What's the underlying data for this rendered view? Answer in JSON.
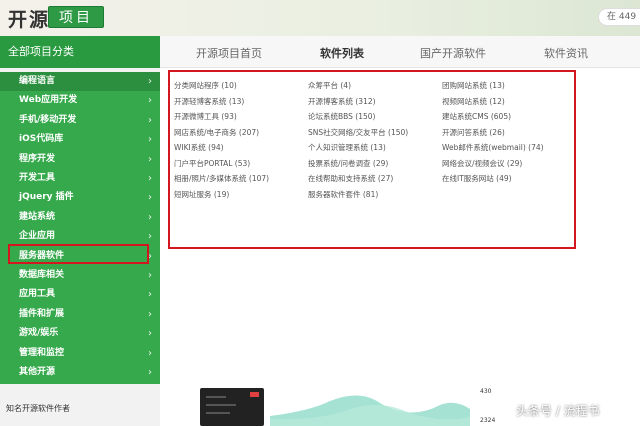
{
  "header": {
    "logo": "开源",
    "logo_tag": "项目",
    "search_text": "在 449"
  },
  "sidebar": {
    "title": "全部项目分类",
    "chevron": "›",
    "items": [
      {
        "label": "编程语言",
        "active": true
      },
      {
        "label": "Web应用开发",
        "active": false
      },
      {
        "label": "手机/移动开发",
        "active": false
      },
      {
        "label": "iOS代码库",
        "active": false
      },
      {
        "label": "程序开发",
        "active": false
      },
      {
        "label": "开发工具",
        "active": false
      },
      {
        "label": "jQuery 插件",
        "active": false
      },
      {
        "label": "建站系统",
        "active": true
      },
      {
        "label": "企业应用",
        "active": false
      },
      {
        "label": "服务器软件",
        "active": false
      },
      {
        "label": "数据库相关",
        "active": false
      },
      {
        "label": "应用工具",
        "active": false
      },
      {
        "label": "插件和扩展",
        "active": false
      },
      {
        "label": "游戏/娱乐",
        "active": false
      },
      {
        "label": "管理和监控",
        "active": false
      },
      {
        "label": "其他开源",
        "active": false
      }
    ],
    "bottom_label": "知名开源软件作者"
  },
  "tabs": [
    {
      "label": "开源项目首页",
      "active": false
    },
    {
      "label": "软件列表",
      "active": true
    },
    {
      "label": "国产开源软件",
      "active": false
    },
    {
      "label": "软件资讯",
      "active": false
    }
  ],
  "categories": [
    [
      "分类网站程序 (10)",
      "众筹平台 (4)",
      "团购网站系统 (13)"
    ],
    [
      "开源轻博客系统 (13)",
      "开源博客系统 (312)",
      "视频网站系统 (12)"
    ],
    [
      "开源微博工具 (93)",
      "论坛系统BBS (150)",
      "建站系统CMS (605)"
    ],
    [
      "网店系统/电子商务 (207)",
      "SNS社交网络/交友平台 (150)",
      "开源问答系统 (26)"
    ],
    [
      "WIKI系统 (94)",
      "个人知识管理系统 (13)",
      "Web邮件系统(webmail) (74)"
    ],
    [
      "门户平台PORTAL (53)",
      "投票系统/问卷调查 (29)",
      "网络会议/视频会议 (29)"
    ],
    [
      "相册/照片/多媒体系统 (107)",
      "在线帮助和支持系统 (27)",
      "在线IT服务网站 (49)"
    ],
    [
      "短网址服务 (19)",
      "服务器软件套件 (81)",
      ""
    ]
  ],
  "preview": {
    "stats": [
      "430",
      "2324"
    ]
  },
  "watermark": "头条号 / 流程书",
  "colors": {
    "green": "#36a94c",
    "dark_green": "#2a9a41",
    "highlight": "#d4161f"
  }
}
